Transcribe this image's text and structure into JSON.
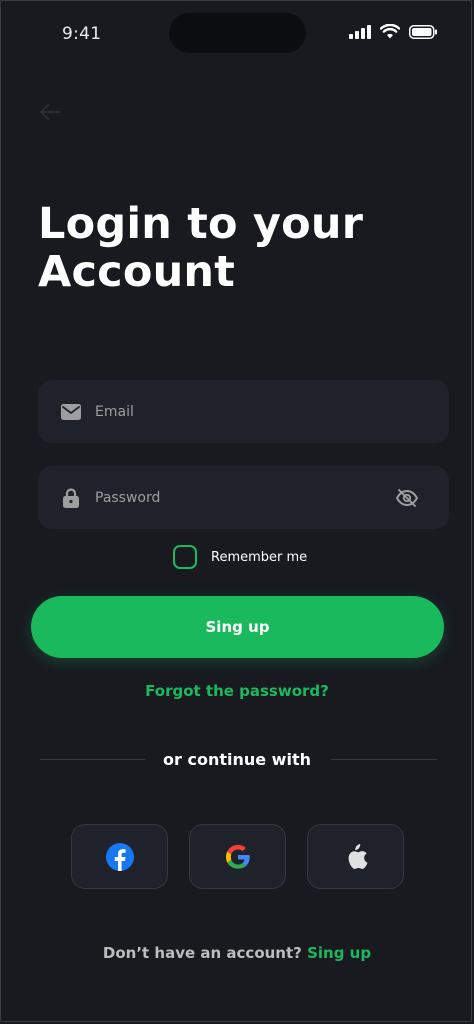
{
  "status_bar": {
    "time": "9:41"
  },
  "header": {
    "title": "Login to your Account"
  },
  "form": {
    "email": {
      "placeholder": "Email",
      "value": ""
    },
    "password": {
      "placeholder": "Password",
      "value": ""
    },
    "remember_label": "Remember me",
    "remember_checked": false,
    "submit_label": "Sing up",
    "forgot_label": "Forgot the password?"
  },
  "social": {
    "divider_label": "or continue with",
    "providers": [
      {
        "name": "facebook-icon"
      },
      {
        "name": "google-icon"
      },
      {
        "name": "apple-icon"
      }
    ]
  },
  "footer": {
    "prompt": "Don’t have an account?",
    "link_label": "Sing up"
  },
  "colors": {
    "background": "#181A20",
    "field": "#1F222A",
    "accent": "#1BB95E",
    "muted": "#9E9E9E"
  }
}
